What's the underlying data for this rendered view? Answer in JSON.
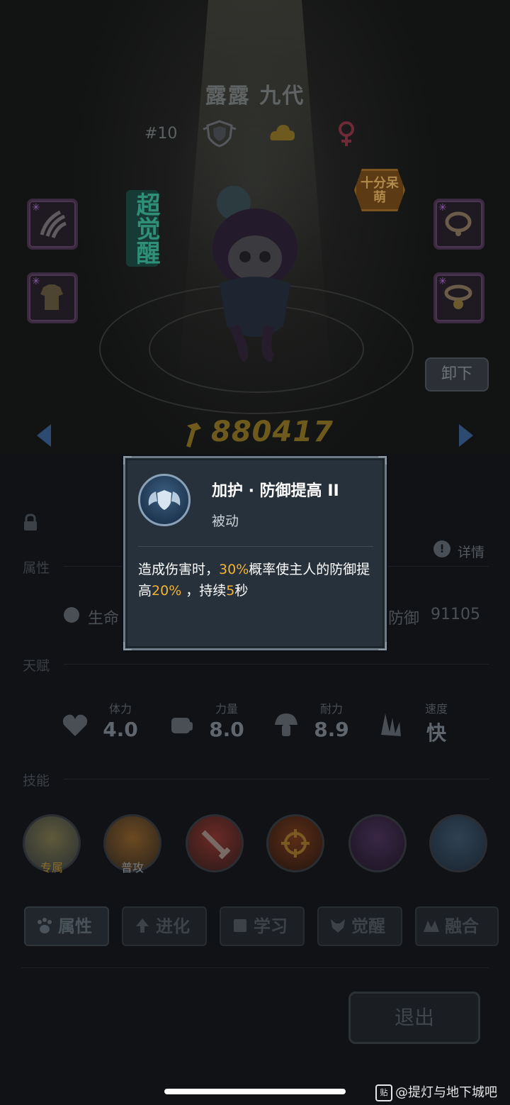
{
  "character": {
    "name": "露露 九代",
    "rank": "#10",
    "super_awaken": "超觉醒",
    "trait_badge": "十分呆萌",
    "unequip_label": "卸下",
    "power": "880417"
  },
  "panel": {
    "attr_section": "属性",
    "detail_label": "详情",
    "hp_label": "生命",
    "def_label": "防御",
    "def_value": "91105",
    "talent_section": "天赋",
    "talents": [
      {
        "label": "体力",
        "value": "4.0",
        "icon": "heart-icon"
      },
      {
        "label": "力量",
        "value": "8.0",
        "icon": "fist-icon"
      },
      {
        "label": "耐力",
        "value": "8.9",
        "icon": "mushroom-icon"
      },
      {
        "label": "速度",
        "value": "快",
        "icon": "wing-icon"
      }
    ],
    "skill_section": "技能",
    "skills": [
      {
        "tag": "专属"
      },
      {
        "tag": "普攻"
      },
      {
        "tag": ""
      },
      {
        "tag": ""
      },
      {
        "tag": ""
      },
      {
        "tag": ""
      }
    ],
    "tabs": [
      {
        "label": "属性",
        "icon": "paw-icon",
        "active": true
      },
      {
        "label": "进化",
        "icon": "evolve-arrow-icon",
        "active": false
      },
      {
        "label": "学习",
        "icon": "book-icon",
        "active": false
      },
      {
        "label": "觉醒",
        "icon": "fox-icon",
        "active": false
      },
      {
        "label": "融合",
        "icon": "merge-icon",
        "active": false
      }
    ],
    "exit_label": "退出"
  },
  "popup": {
    "title": "加护 · 防御提高 II",
    "subtitle": "被动",
    "desc_parts": [
      "造成伤害时，",
      "30%",
      "概率使主人的防御提高",
      "20%",
      " ，持续",
      "5",
      "秒"
    ]
  },
  "watermark": "@提灯与地下城吧",
  "colors": {
    "highlight": "#f3b333",
    "popup_bg": "#27313b",
    "panel_bg": "#101215"
  }
}
